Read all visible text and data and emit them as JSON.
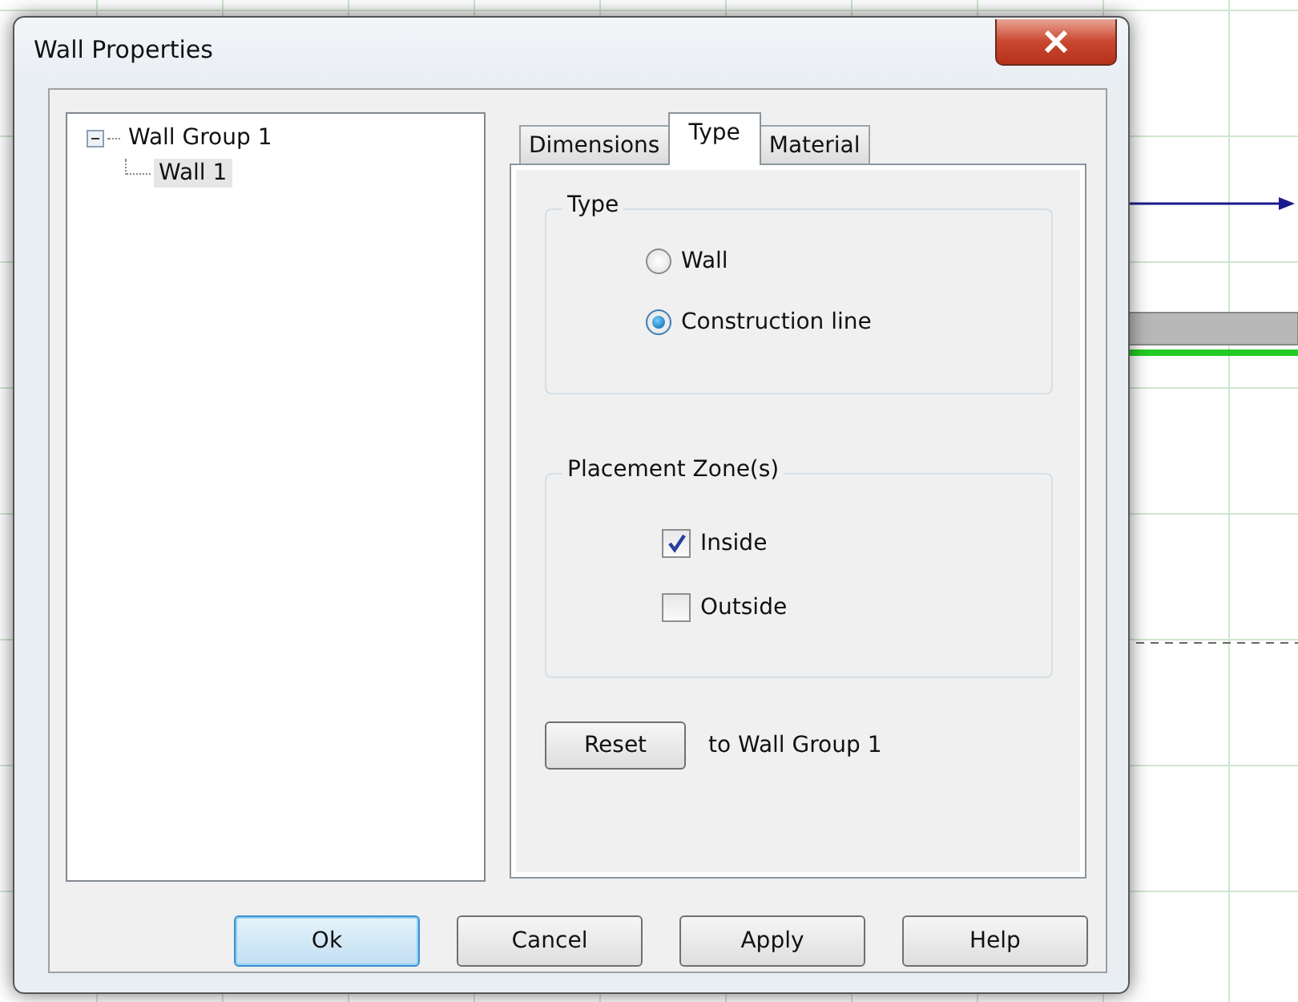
{
  "window": {
    "title": "Wall Properties"
  },
  "tree": [
    {
      "label": "Wall Group 1",
      "expanded": true,
      "selected": false,
      "children": [
        {
          "label": "Wall 1",
          "selected": true
        }
      ]
    }
  ],
  "tabs": [
    {
      "label": "Dimensions",
      "selected": false
    },
    {
      "label": "Type",
      "selected": true
    },
    {
      "label": "Material",
      "selected": false
    }
  ],
  "type_group": {
    "title": "Type",
    "options": [
      {
        "label": "Wall",
        "selected": false
      },
      {
        "label": "Construction line",
        "selected": true
      }
    ]
  },
  "placement_group": {
    "title": "Placement Zone(s)",
    "options": [
      {
        "label": "Inside",
        "checked": true
      },
      {
        "label": "Outside",
        "checked": false
      }
    ]
  },
  "reset": {
    "button": "Reset",
    "note": "to Wall Group 1"
  },
  "buttons": [
    {
      "label": "Ok",
      "default": true
    },
    {
      "label": "Cancel",
      "default": false
    },
    {
      "label": "Apply",
      "default": false
    },
    {
      "label": "Help",
      "default": false
    }
  ]
}
